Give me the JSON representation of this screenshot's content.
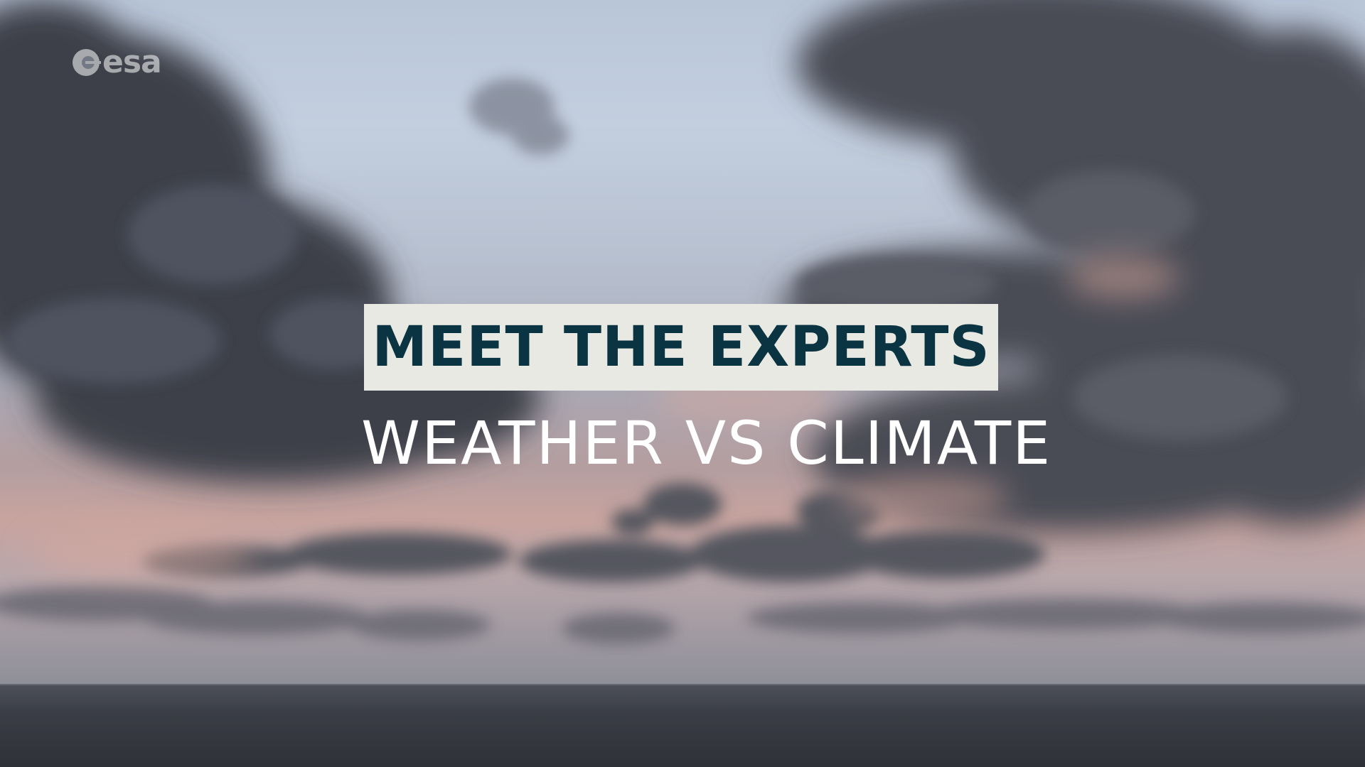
{
  "logo": {
    "text": "esa",
    "icon": "esa-logo-icon"
  },
  "title": {
    "text": "MEET THE EXPERTS",
    "box_color": "#e9e9e4",
    "text_color": "#0b3442"
  },
  "subtitle": {
    "text": "WEATHER VS CLIMATE",
    "color": "#ffffff"
  }
}
